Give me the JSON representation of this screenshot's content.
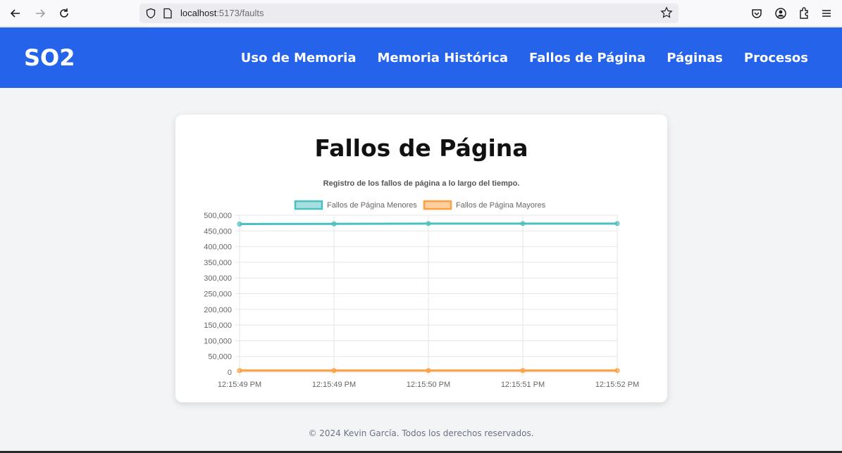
{
  "browser": {
    "url_host": "localhost",
    "url_rest": ":5173/faults",
    "icons": [
      "back-arrow-icon",
      "forward-arrow-icon",
      "reload-icon",
      "shield-icon",
      "page-icon",
      "star-icon",
      "pocket-icon",
      "account-icon",
      "extensions-icon",
      "menu-icon"
    ]
  },
  "header": {
    "brand": "SO2",
    "nav": [
      "Uso de Memoria",
      "Memoria Histórica",
      "Fallos de Página",
      "Páginas",
      "Procesos"
    ],
    "bg_color": "#2563eb"
  },
  "page": {
    "title": "Fallos de Página"
  },
  "chart_data": {
    "type": "line",
    "title": "Registro de los fallos de página a lo largo del tiempo.",
    "categories": [
      "12:15:49 PM",
      "12:15:49 PM",
      "12:15:50 PM",
      "12:15:51 PM",
      "12:15:52 PM"
    ],
    "series": [
      {
        "name": "Fallos de Página Menores",
        "values": [
          472000,
          472500,
          473500,
          473500,
          473500
        ],
        "color": "#4bc0c0"
      },
      {
        "name": "Fallos de Página Mayores",
        "values": [
          5000,
          5000,
          5000,
          5000,
          5000
        ],
        "color": "#ff9f40"
      }
    ],
    "ylim": [
      0,
      500000
    ],
    "yticks": [
      "0",
      "50,000",
      "100,000",
      "150,000",
      "200,000",
      "250,000",
      "300,000",
      "350,000",
      "400,000",
      "450,000",
      "500,000"
    ],
    "legend": "top",
    "grid": true
  },
  "footer": {
    "text": "© 2024 Kevin García. Todos los derechos reservados."
  }
}
